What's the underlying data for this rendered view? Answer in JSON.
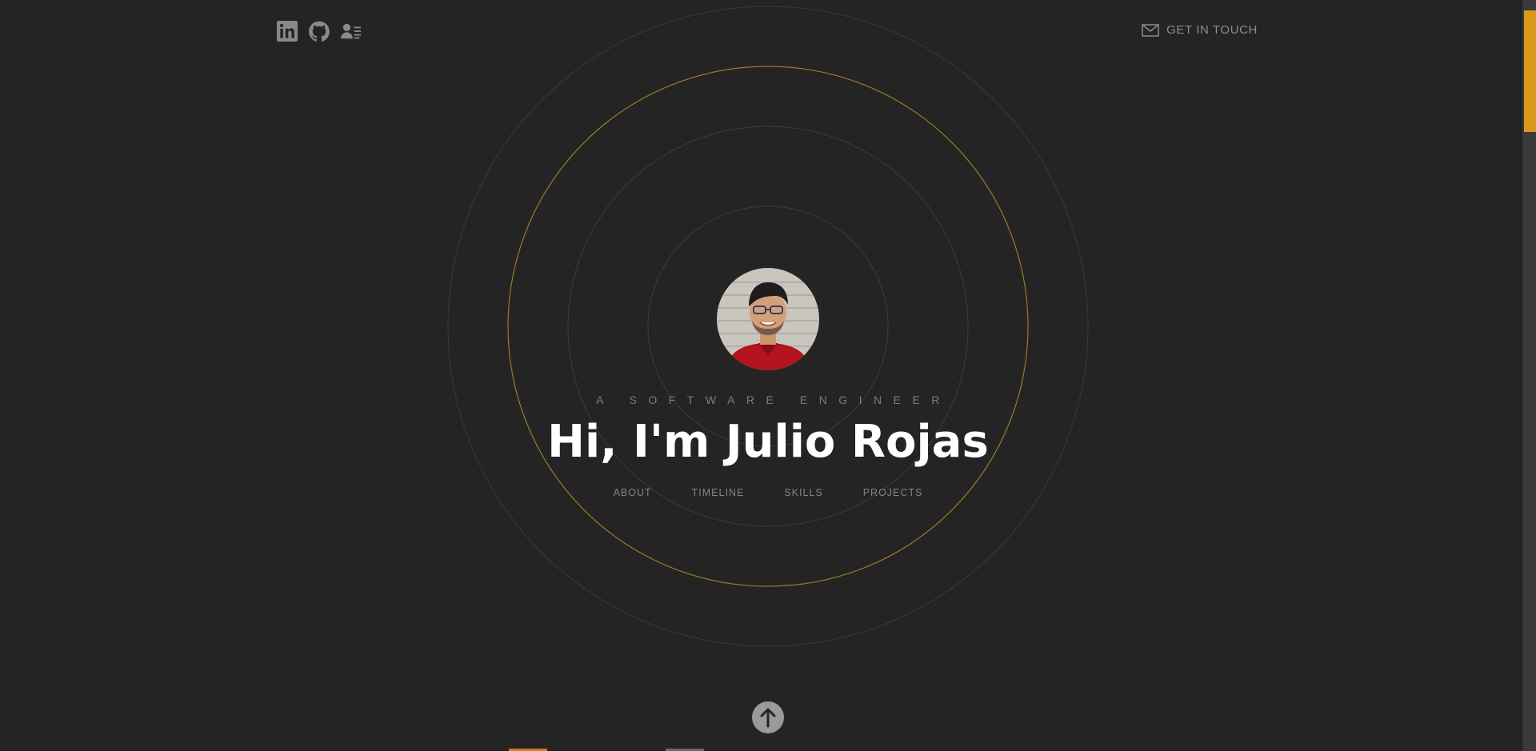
{
  "social": [
    {
      "name": "linkedin",
      "icon": "linkedin-icon"
    },
    {
      "name": "github",
      "icon": "github-icon"
    },
    {
      "name": "resume",
      "icon": "contact-card-icon"
    }
  ],
  "contact": {
    "label": "GET IN TOUCH",
    "icon": "mail-icon"
  },
  "hero": {
    "tagline": "A SOFTWARE ENGINEER",
    "headline": "Hi, I'm Julio Rojas",
    "avatar_icon": "profile-photo"
  },
  "nav": {
    "about": "ABOUT",
    "timeline": "TIMELINE",
    "skills": "SKILLS",
    "projects": "PROJECTS"
  },
  "scroll_up": {
    "icon": "arrow-up-icon"
  },
  "colors": {
    "background": "#242424",
    "accent": "#d99a1c",
    "ring": "#3a3a3a",
    "accent_ring": "#9c7a2a",
    "text_muted": "#848484"
  }
}
